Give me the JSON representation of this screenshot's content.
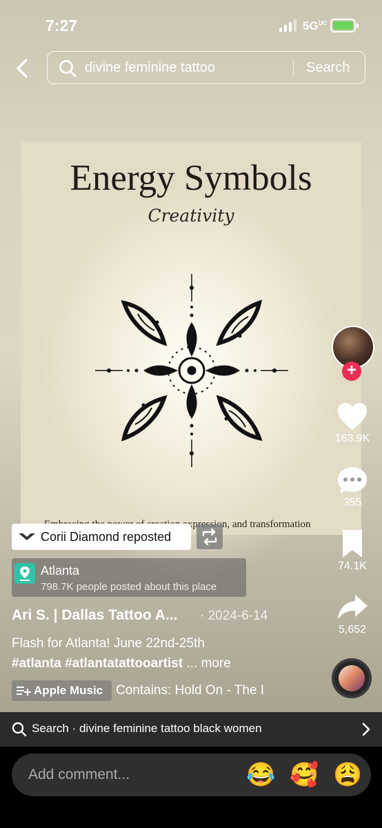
{
  "status_bar": {
    "time": "7:27",
    "network": "5G",
    "network_suffix": "UC"
  },
  "search": {
    "query": "divine feminine tattoo",
    "button": "Search"
  },
  "post_image": {
    "title": "Energy Symbols",
    "subtitle": "Creativity",
    "footer": "Embracing the power of creation expression, and transformation"
  },
  "repost": {
    "label": "Corii Diamond reposted"
  },
  "location": {
    "name": "Atlanta",
    "detail": "798.7K people posted about this place"
  },
  "author": {
    "name": "Ari S. | Dallas Tattoo A...",
    "date": "· 2024-6-14"
  },
  "caption": {
    "line1": "Flash for Atlanta! June 22nd-25th",
    "hashtags": "#atlanta #atlantatattooartist",
    "more": "... more"
  },
  "music": {
    "label": "Apple Music",
    "text": "Contains: Hold On - The I"
  },
  "actions": {
    "likes": "163.9K",
    "comments": "355",
    "saves": "74.1K",
    "shares": "5,652",
    "follow": "+"
  },
  "related_search": {
    "text": "Search · divine feminine tattoo black women"
  },
  "comment_bar": {
    "placeholder": "Add comment...",
    "emojis": [
      "😂",
      "🥰",
      "😩"
    ]
  },
  "colors": {
    "like_pink": "#ec2d55",
    "location_green": "#2ec4a6",
    "battery_green": "#6bd55b"
  },
  "icons": [
    "back-icon",
    "search-icon",
    "signal-icon",
    "battery-icon",
    "repost-icon",
    "location-pin-icon",
    "heart-icon",
    "comment-icon",
    "bookmark-icon",
    "share-icon",
    "music-list-icon",
    "chevron-right-icon"
  ]
}
